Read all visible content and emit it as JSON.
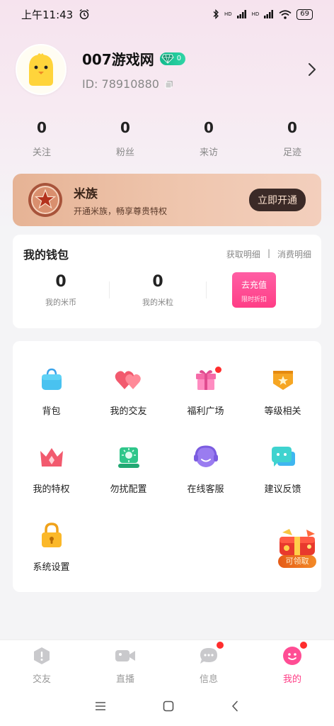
{
  "status_bar": {
    "time": "上午11:43",
    "battery": "69",
    "signal_labels": [
      "HD",
      "HD"
    ]
  },
  "profile": {
    "username": "007游戏网",
    "badge_count": "0",
    "id_text": "ID: 78910880"
  },
  "stats": [
    {
      "value": "0",
      "label": "关注"
    },
    {
      "value": "0",
      "label": "粉丝"
    },
    {
      "value": "0",
      "label": "来访"
    },
    {
      "value": "0",
      "label": "足迹"
    }
  ],
  "membership": {
    "title": "米族",
    "description": "开通米族，畅享尊贵特权",
    "button": "立即开通"
  },
  "wallet": {
    "title": "我的钱包",
    "link_earn": "获取明细",
    "link_separator": "|",
    "link_spend": "消费明细",
    "coins_value": "0",
    "coins_label": "我的米币",
    "grains_value": "0",
    "grains_label": "我的米粒",
    "recharge_label": "去充值",
    "recharge_sub": "限时折扣"
  },
  "features": [
    {
      "label": "背包",
      "icon": "bag-icon"
    },
    {
      "label": "我的交友",
      "icon": "hearts-icon"
    },
    {
      "label": "福利广场",
      "icon": "gift-box-icon"
    },
    {
      "label": "等级相关",
      "icon": "level-badge-icon"
    },
    {
      "label": "我的特权",
      "icon": "crown-icon"
    },
    {
      "label": "勿扰配置",
      "icon": "do-not-disturb-icon"
    },
    {
      "label": "在线客服",
      "icon": "headset-icon"
    },
    {
      "label": "建议反馈",
      "icon": "feedback-chat-icon"
    },
    {
      "label": "系统设置",
      "icon": "lock-icon"
    }
  ],
  "floating_gift": {
    "label": "可领取"
  },
  "tabs": [
    {
      "label": "交友",
      "icon": "friends-icon",
      "active": false
    },
    {
      "label": "直播",
      "icon": "video-camera-icon",
      "active": false
    },
    {
      "label": "信息",
      "icon": "message-icon",
      "active": false
    },
    {
      "label": "我的",
      "icon": "profile-icon",
      "active": true
    }
  ],
  "colors": {
    "accent": "#ff3d86",
    "vip_green": "#13b98c",
    "member_dark": "#3b2a27"
  }
}
